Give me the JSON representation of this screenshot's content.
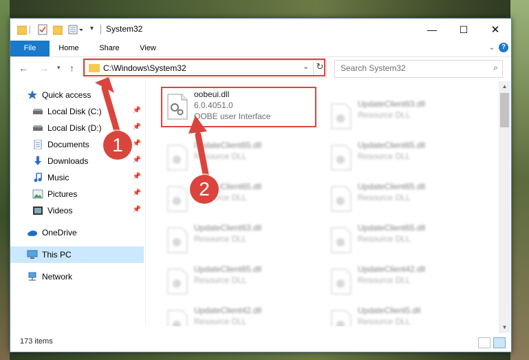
{
  "window": {
    "title": "System32"
  },
  "ribbon": {
    "tabs": [
      "File",
      "Home",
      "Share",
      "View"
    ]
  },
  "address": {
    "path": "C:\\Windows\\System32"
  },
  "search": {
    "placeholder": "Search System32"
  },
  "sidebar": {
    "items": [
      {
        "label": "Quick access",
        "icon": "star-icon",
        "pinned": false
      },
      {
        "label": "Local Disk (C:)",
        "icon": "drive-icon",
        "pinned": true
      },
      {
        "label": "Local Disk (D:)",
        "icon": "drive-icon",
        "pinned": true
      },
      {
        "label": "Documents",
        "icon": "documents-icon",
        "pinned": true
      },
      {
        "label": "Downloads",
        "icon": "download-icon",
        "pinned": true
      },
      {
        "label": "Music",
        "icon": "music-icon",
        "pinned": true
      },
      {
        "label": "Pictures",
        "icon": "pictures-icon",
        "pinned": true
      },
      {
        "label": "Videos",
        "icon": "videos-icon",
        "pinned": true
      },
      {
        "label": "OneDrive",
        "icon": "onedrive-icon",
        "pinned": false
      },
      {
        "label": "This PC",
        "icon": "pc-icon",
        "pinned": false,
        "selected": true
      },
      {
        "label": "Network",
        "icon": "network-icon",
        "pinned": false
      }
    ]
  },
  "files": {
    "highlighted": {
      "name": "oobeui.dll",
      "version": "6.0.4051.0",
      "description": "OOBE user Interface"
    },
    "left": [
      {
        "name": "UpdateClient65.dll",
        "type": "Resource DLL"
      },
      {
        "name": "UpdateClient65.dll",
        "type": "Resource DLL"
      },
      {
        "name": "UpdateClient63.dll",
        "type": "Resource DLL"
      },
      {
        "name": "UpdateClient65.dll",
        "type": "Resource DLL"
      },
      {
        "name": "UpdateClient42.dll",
        "type": "Resource DLL"
      }
    ],
    "right": [
      {
        "name": "UpdateClient63.dll",
        "type": "Resource DLL"
      },
      {
        "name": "UpdateClient65.dll",
        "type": "Resource DLL"
      },
      {
        "name": "UpdateClient65.dll",
        "type": "Resource DLL"
      },
      {
        "name": "UpdateClient65.dll",
        "type": "Resource DLL"
      },
      {
        "name": "UpdateClient42.dll",
        "type": "Resource DLL"
      },
      {
        "name": "UpdateClient5.dll",
        "type": "Resource DLL"
      }
    ]
  },
  "status": {
    "items": "173 items"
  },
  "callouts": [
    "1",
    "2"
  ],
  "colors": {
    "accent": "#1979ca",
    "highlight": "#d9453d",
    "selected": "#cce8ff"
  }
}
